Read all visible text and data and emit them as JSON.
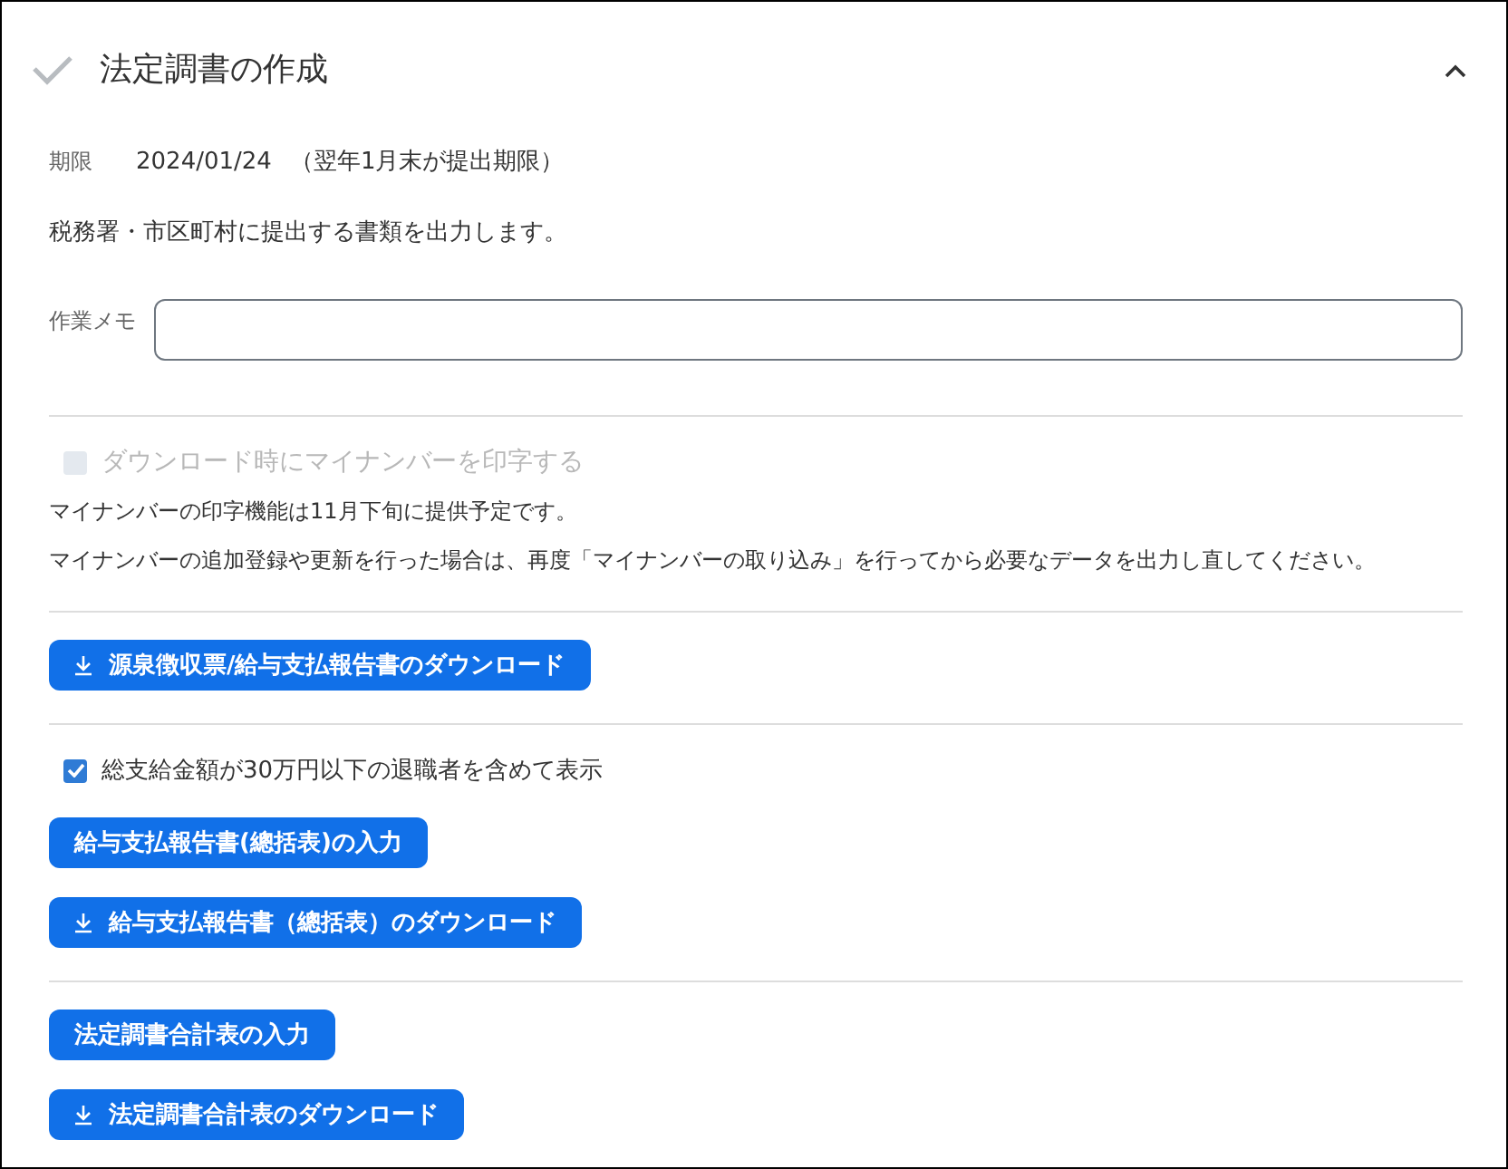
{
  "panel": {
    "title": "法定調書の作成",
    "expanded": true
  },
  "deadline": {
    "label": "期限",
    "date": "2024/01/24",
    "note": "（翌年1月末が提出期限）"
  },
  "description": "税務署・市区町村に提出する書類を出力します。",
  "memo": {
    "label": "作業メモ"
  },
  "sections": [
    [
      {
        "kind": "checkbox",
        "label": "ダウンロード時にマイナンバーを印字する",
        "checked": false,
        "disabled": true
      },
      {
        "kind": "note",
        "text": "マイナンバーの印字機能は11月下旬に提供予定です。"
      },
      {
        "kind": "note",
        "text": "マイナンバーの追加登録や更新を行った場合は、再度「マイナンバーの取り込み」を行ってから必要なデータを出力し直してください。"
      }
    ],
    [
      {
        "kind": "button",
        "label": "源泉徴収票/給与支払報告書のダウンロード",
        "download": true
      }
    ],
    [
      {
        "kind": "checkbox",
        "label": "総支給金額が30万円以下の退職者を含めて表示",
        "checked": true,
        "disabled": false
      },
      {
        "kind": "button",
        "label": "給与支払報告書(總括表)の入力",
        "download": false
      },
      {
        "kind": "button",
        "label": "給与支払報告書（總括表）のダウンロード",
        "download": true
      }
    ],
    [
      {
        "kind": "button",
        "label": "法定調書合計表の入力",
        "download": false
      },
      {
        "kind": "button",
        "label": "法定調書合計表のダウンロード",
        "download": true
      }
    ]
  ]
}
